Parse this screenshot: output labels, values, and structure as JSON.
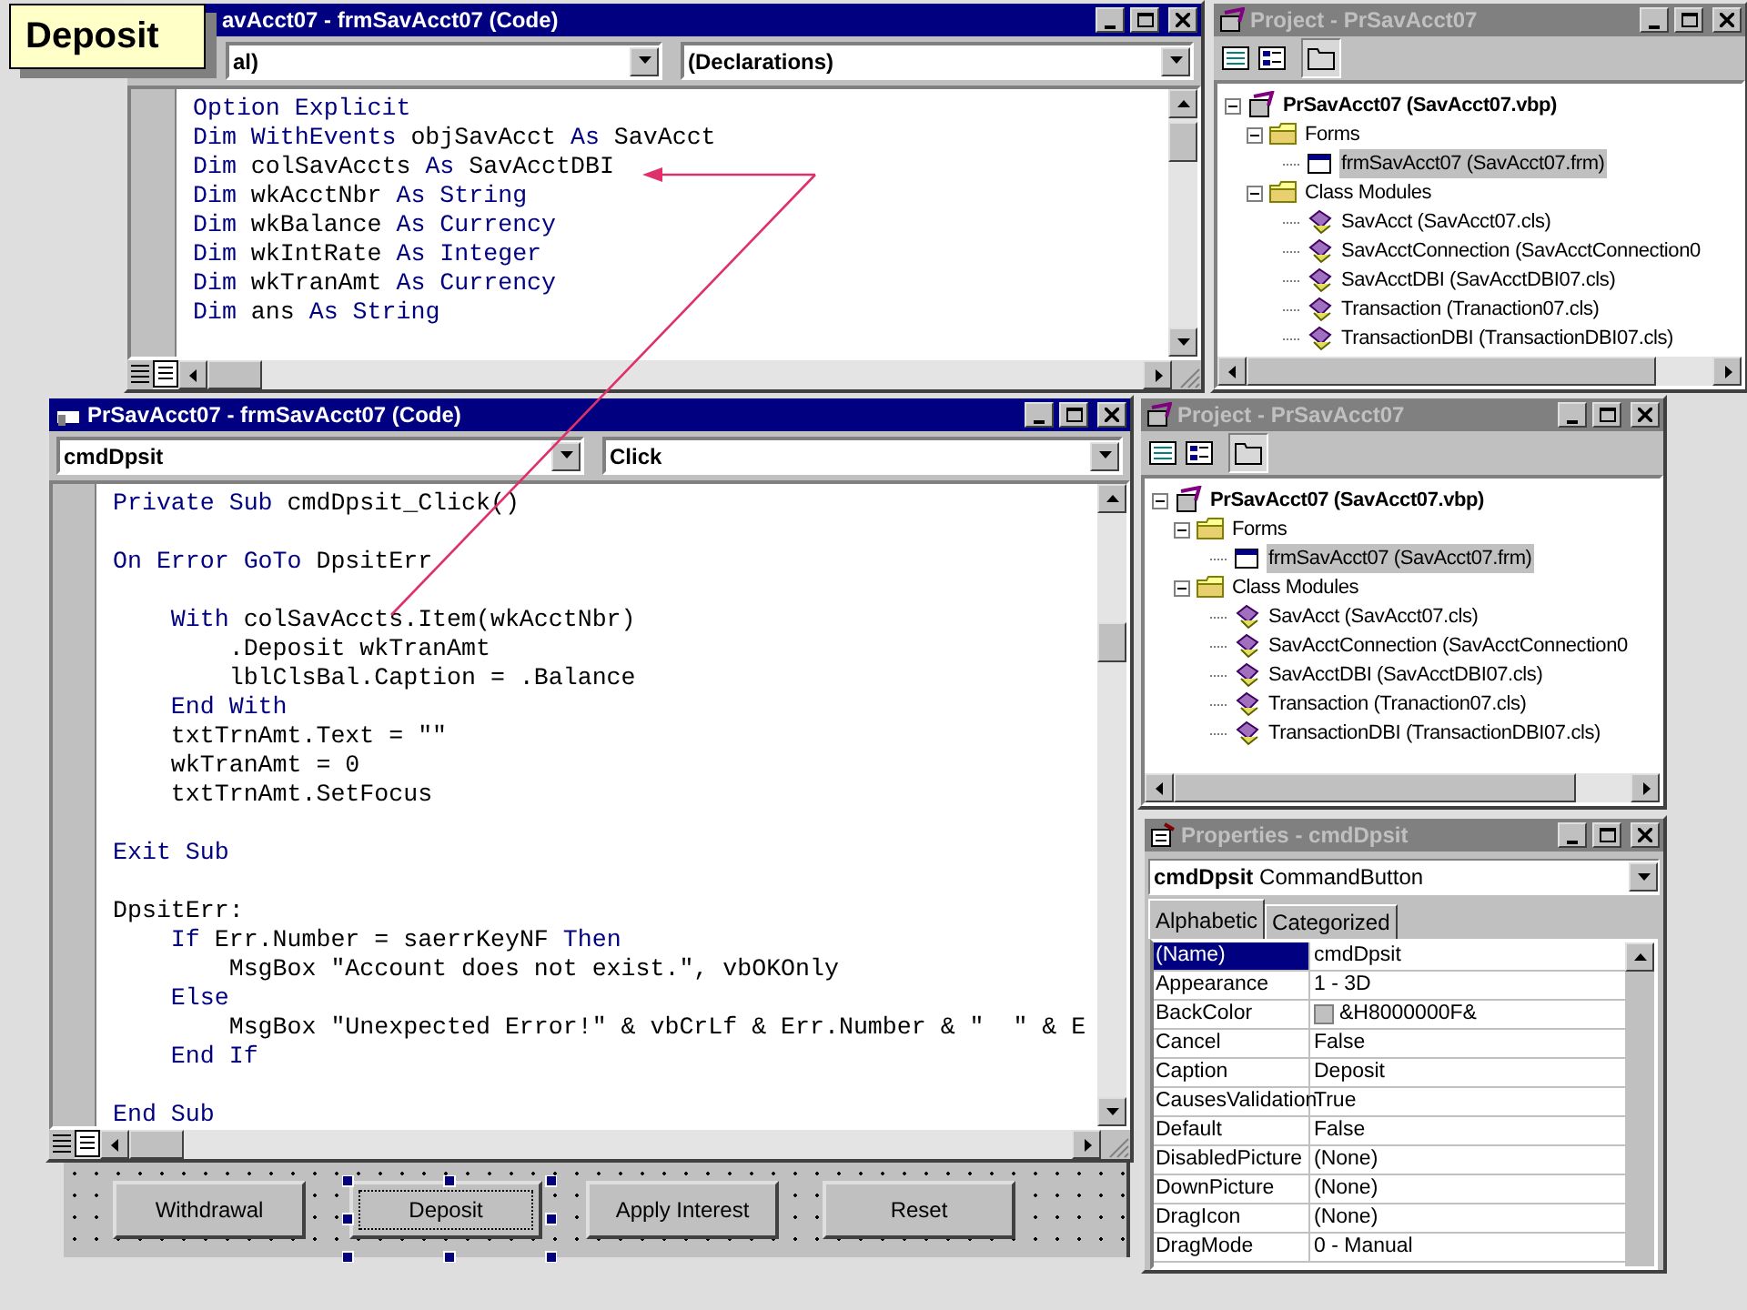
{
  "callout": {
    "text": "Deposit"
  },
  "code_windows": [
    {
      "title": "avAcct07 - frmSavAcct07 (Code)",
      "active": true,
      "object_box": "al)",
      "procedure_box": "(Declarations)",
      "lines": [
        {
          "segments": [
            {
              "kind": "keyword",
              "text": "Option Explicit"
            }
          ]
        },
        {
          "segments": [
            {
              "kind": "keyword",
              "text": "Dim WithEvents"
            },
            {
              "kind": "plain",
              "text": " objSavAcct "
            },
            {
              "kind": "keyword",
              "text": "As"
            },
            {
              "kind": "plain",
              "text": " SavAcct"
            }
          ]
        },
        {
          "segments": [
            {
              "kind": "keyword",
              "text": "Dim"
            },
            {
              "kind": "plain",
              "text": " colSavAccts "
            },
            {
              "kind": "keyword",
              "text": "As"
            },
            {
              "kind": "plain",
              "text": " SavAcctDBI"
            }
          ]
        },
        {
          "segments": [
            {
              "kind": "keyword",
              "text": "Dim"
            },
            {
              "kind": "plain",
              "text": " wkAcctNbr "
            },
            {
              "kind": "keyword",
              "text": "As String"
            }
          ]
        },
        {
          "segments": [
            {
              "kind": "keyword",
              "text": "Dim"
            },
            {
              "kind": "plain",
              "text": " wkBalance "
            },
            {
              "kind": "keyword",
              "text": "As Currency"
            }
          ]
        },
        {
          "segments": [
            {
              "kind": "keyword",
              "text": "Dim"
            },
            {
              "kind": "plain",
              "text": " wkIntRate "
            },
            {
              "kind": "keyword",
              "text": "As Integer"
            }
          ]
        },
        {
          "segments": [
            {
              "kind": "keyword",
              "text": "Dim"
            },
            {
              "kind": "plain",
              "text": " wkTranAmt "
            },
            {
              "kind": "keyword",
              "text": "As Currency"
            }
          ]
        },
        {
          "segments": [
            {
              "kind": "keyword",
              "text": "Dim"
            },
            {
              "kind": "plain",
              "text": " ans "
            },
            {
              "kind": "keyword",
              "text": "As String"
            }
          ]
        }
      ]
    },
    {
      "title": "PrSavAcct07 - frmSavAcct07 (Code)",
      "active": true,
      "object_box": "cmdDpsit",
      "procedure_box": "Click",
      "lines": [
        {
          "segments": [
            {
              "kind": "keyword",
              "text": "Private Sub"
            },
            {
              "kind": "plain",
              "text": " cmdDpsit_Click()"
            }
          ]
        },
        {
          "blank_before": true,
          "segments": [
            {
              "kind": "keyword",
              "text": "On Error GoTo"
            },
            {
              "kind": "plain",
              "text": " DpsitErr"
            }
          ]
        },
        {
          "blank_before": true,
          "segments": [
            {
              "kind": "keyword",
              "text": "    With"
            },
            {
              "kind": "plain",
              "text": " colSavAccts.Item(wkAcctNbr)"
            }
          ]
        },
        {
          "segments": [
            {
              "kind": "plain",
              "text": "        .Deposit wkTranAmt"
            }
          ]
        },
        {
          "segments": [
            {
              "kind": "plain",
              "text": "        lblClsBal.Caption = .Balance"
            }
          ]
        },
        {
          "segments": [
            {
              "kind": "keyword",
              "text": "    End With"
            }
          ]
        },
        {
          "segments": [
            {
              "kind": "plain",
              "text": "    txtTrnAmt.Text = \"\""
            }
          ]
        },
        {
          "segments": [
            {
              "kind": "plain",
              "text": "    wkTranAmt = 0"
            }
          ]
        },
        {
          "segments": [
            {
              "kind": "plain",
              "text": "    txtTrnAmt.SetFocus"
            }
          ]
        },
        {
          "blank_before": true,
          "segments": [
            {
              "kind": "keyword",
              "text": "Exit Sub"
            }
          ]
        },
        {
          "blank_before": true,
          "segments": [
            {
              "kind": "plain",
              "text": "DpsitErr:"
            }
          ]
        },
        {
          "segments": [
            {
              "kind": "keyword",
              "text": "    If"
            },
            {
              "kind": "plain",
              "text": " Err.Number = saerrKeyNF "
            },
            {
              "kind": "keyword",
              "text": "Then"
            }
          ]
        },
        {
          "segments": [
            {
              "kind": "plain",
              "text": "        MsgBox \"Account does not exist.\", vbOKOnly"
            }
          ]
        },
        {
          "segments": [
            {
              "kind": "keyword",
              "text": "    Else"
            }
          ]
        },
        {
          "segments": [
            {
              "kind": "plain",
              "text": "        MsgBox \"Unexpected Error!\" & vbCrLf & Err.Number & \"  \" & E"
            }
          ]
        },
        {
          "segments": [
            {
              "kind": "keyword",
              "text": "    End If"
            }
          ]
        },
        {
          "blank_before": true,
          "segments": [
            {
              "kind": "keyword",
              "text": "End Sub"
            }
          ]
        }
      ]
    }
  ],
  "project_windows": [
    {
      "title": "Project - PrSavAcct07",
      "active": false,
      "tree": {
        "label": "PrSavAcct07 (SavAcct07.vbp)",
        "kind": "project",
        "expanded": true,
        "selected": false,
        "children": [
          {
            "label": "Forms",
            "kind": "folder",
            "expanded": true,
            "selected": false,
            "children": [
              {
                "label": "frmSavAcct07 (SavAcct07.frm)",
                "kind": "form",
                "selected": true
              }
            ]
          },
          {
            "label": "Class Modules",
            "kind": "folder",
            "expanded": true,
            "selected": false,
            "children": [
              {
                "label": "SavAcct (SavAcct07.cls)",
                "kind": "class",
                "selected": false
              },
              {
                "label": "SavAcctConnection (SavAcctConnection0",
                "kind": "class",
                "selected": false
              },
              {
                "label": "SavAcctDBI (SavAcctDBI07.cls)",
                "kind": "class",
                "selected": false
              },
              {
                "label": "Transaction (Tranaction07.cls)",
                "kind": "class",
                "selected": false
              },
              {
                "label": "TransactionDBI (TransactionDBI07.cls)",
                "kind": "class",
                "selected": false
              }
            ]
          }
        ]
      }
    },
    {
      "title": "Project - PrSavAcct07",
      "active": false,
      "tree": {
        "label": "PrSavAcct07 (SavAcct07.vbp)",
        "kind": "project",
        "expanded": true,
        "selected": false,
        "children": [
          {
            "label": "Forms",
            "kind": "folder",
            "expanded": true,
            "selected": false,
            "children": [
              {
                "label": "frmSavAcct07 (SavAcct07.frm)",
                "kind": "form",
                "selected": true
              }
            ]
          },
          {
            "label": "Class Modules",
            "kind": "folder",
            "expanded": true,
            "selected": false,
            "children": [
              {
                "label": "SavAcct (SavAcct07.cls)",
                "kind": "class",
                "selected": false
              },
              {
                "label": "SavAcctConnection (SavAcctConnection0",
                "kind": "class",
                "selected": false
              },
              {
                "label": "SavAcctDBI (SavAcctDBI07.cls)",
                "kind": "class",
                "selected": false
              },
              {
                "label": "Transaction (Tranaction07.cls)",
                "kind": "class",
                "selected": false
              },
              {
                "label": "TransactionDBI (TransactionDBI07.cls)",
                "kind": "class",
                "selected": false
              }
            ]
          }
        ]
      }
    }
  ],
  "properties": {
    "title": "Properties - cmdDpsit",
    "active": false,
    "object_name": "cmdDpsit",
    "object_type": "CommandButton",
    "tabs": [
      {
        "label": "Alphabetic",
        "selected": true
      },
      {
        "label": "Categorized",
        "selected": false
      }
    ],
    "rows": [
      {
        "name": "(Name)",
        "value": "cmdDpsit",
        "kind": "text",
        "selected": true
      },
      {
        "name": "Appearance",
        "value": "1 - 3D",
        "kind": "text",
        "selected": false
      },
      {
        "name": "BackColor",
        "value": "&H8000000F&",
        "kind": "color",
        "selected": false
      },
      {
        "name": "Cancel",
        "value": "False",
        "kind": "text",
        "selected": false
      },
      {
        "name": "Caption",
        "value": "Deposit",
        "kind": "text",
        "selected": false
      },
      {
        "name": "CausesValidation",
        "value": "True",
        "kind": "text",
        "selected": false
      },
      {
        "name": "Default",
        "value": "False",
        "kind": "text",
        "selected": false
      },
      {
        "name": "DisabledPicture",
        "value": "(None)",
        "kind": "text",
        "selected": false
      },
      {
        "name": "DownPicture",
        "value": "(None)",
        "kind": "text",
        "selected": false
      },
      {
        "name": "DragIcon",
        "value": "(None)",
        "kind": "text",
        "selected": false
      },
      {
        "name": "DragMode",
        "value": "0 - Manual",
        "kind": "text",
        "selected": false
      }
    ]
  },
  "form": {
    "buttons": [
      {
        "label": "Withdrawal",
        "selected": false
      },
      {
        "label": "Deposit",
        "selected": true
      },
      {
        "label": "Apply Interest",
        "selected": false
      },
      {
        "label": "Reset",
        "selected": false
      }
    ]
  }
}
